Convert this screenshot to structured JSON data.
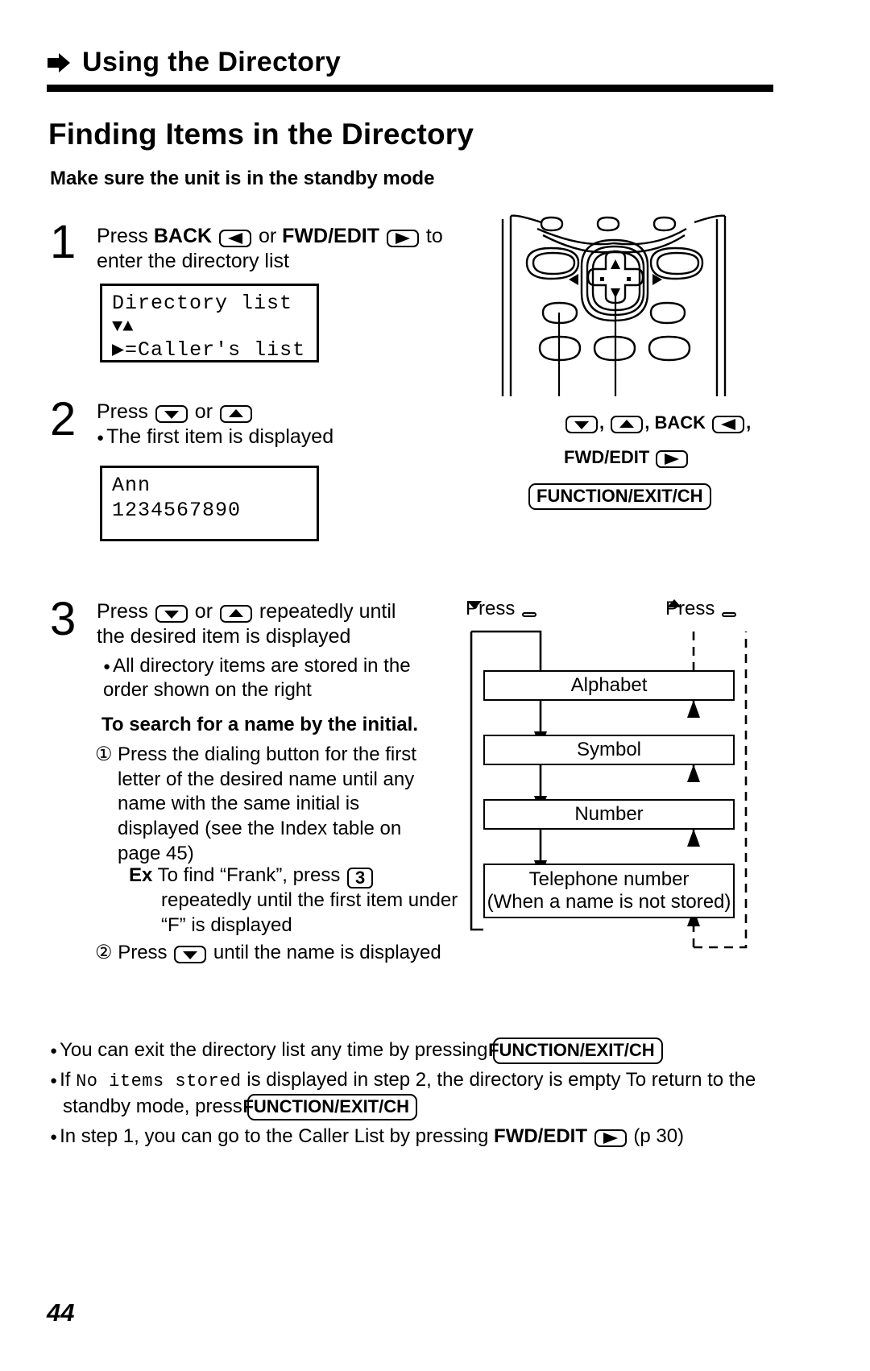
{
  "header": {
    "arrow_icon": "right-triangle-icon",
    "title": "Using the Directory"
  },
  "section": {
    "title": "Finding Items in the Directory",
    "subtitle": "Make sure the unit is in the standby mode"
  },
  "steps": [
    {
      "number": "1",
      "text_a": "Press ",
      "key_back_label": "BACK",
      "text_b": " or ",
      "key_fwd_label": "FWD/EDIT",
      "text_c": " to",
      "text_d": "enter the directory list",
      "lcd": {
        "line1": "Directory list",
        "line2": "▼▲",
        "line3": "▶=Caller's list"
      }
    },
    {
      "number": "2",
      "text_a": "Press ",
      "text_b": " or ",
      "note": "The first item is displayed",
      "lcd": {
        "line1": "Ann",
        "line2": "1234567890"
      }
    },
    {
      "number": "3",
      "text_a": "Press ",
      "text_b": " or ",
      "text_c": " repeatedly until",
      "text_d": "the desired item is displayed",
      "note": "All directory items are stored in the order shown on the right",
      "subhead": "To search for a name by the initial.",
      "sub1_marker": "①",
      "sub1_text": "Press the dialing button for the first letter of the desired name until any name with the same initial is displayed (see the Index table on page 45)",
      "example_label": "Ex",
      "example_text_a": "To find “Frank”, press ",
      "example_key": "3",
      "example_text_b": "repeatedly until the first item under “F” is displayed",
      "sub2_marker": "②",
      "sub2_text_a": "Press ",
      "sub2_text_b": " until the name is displayed"
    }
  ],
  "phone": {
    "caption_keys": ", , BACK ",
    "label_line1_sep": ", ",
    "label_back": "BACK",
    "label_fwd": "FWD/EDIT",
    "label_function": "FUNCTION/EXIT/CH"
  },
  "flow": {
    "press_down_label": "Press",
    "press_up_label": "Press",
    "boxes": [
      {
        "line1": "Alphabet",
        "line2": ""
      },
      {
        "line1": "Symbol",
        "line2": ""
      },
      {
        "line1": "Number",
        "line2": ""
      },
      {
        "line1": "Telephone number",
        "line2": "(When a name is not stored)"
      }
    ]
  },
  "notes": [
    {
      "text_a": "You can exit the directory list any time by pressing ",
      "box": "FUNCTION/EXIT/CH",
      "text_b": ""
    },
    {
      "text_a": "If ",
      "mono": "No items stored",
      "text_b": " is displayed in step 2, the directory is empty  To return to the standby mode, press ",
      "box": "FUNCTION/EXIT/CH",
      "text_c": ""
    },
    {
      "text_a": "In step 1, you can go to the Caller List by pressing ",
      "bold": "FWD/EDIT",
      "text_b": " (p  30)"
    }
  ],
  "page_number": "44"
}
